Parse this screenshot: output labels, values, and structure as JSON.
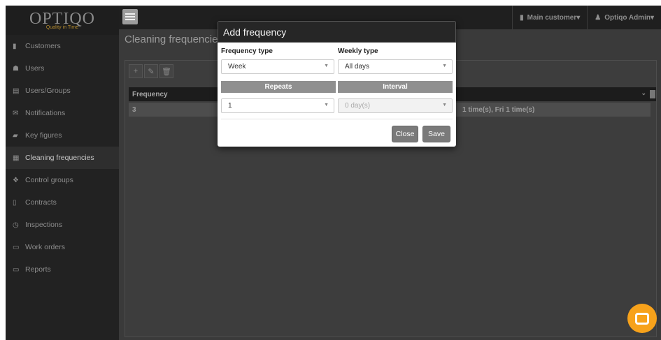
{
  "brand": {
    "name": "OPTIQO",
    "tagline": "Quality in Time"
  },
  "sidebar": {
    "items": [
      {
        "label": "Customers",
        "icon": "building-icon"
      },
      {
        "label": "Users",
        "icon": "users-icon"
      },
      {
        "label": "Users/Groups",
        "icon": "id-card-icon"
      },
      {
        "label": "Notifications",
        "icon": "envelope-icon"
      },
      {
        "label": "Key figures",
        "icon": "book-icon"
      },
      {
        "label": "Cleaning frequencies",
        "icon": "calendar-icon"
      },
      {
        "label": "Control groups",
        "icon": "cubes-icon"
      },
      {
        "label": "Contracts",
        "icon": "file-icon"
      },
      {
        "label": "Inspections",
        "icon": "clock-icon"
      },
      {
        "label": "Work orders",
        "icon": "list-icon"
      },
      {
        "label": "Reports",
        "icon": "monitor-icon"
      }
    ],
    "active_index": 5
  },
  "topbar": {
    "customer_label": "Main customer",
    "user_label": "Optiqo Admin"
  },
  "page": {
    "title": "Cleaning frequencies"
  },
  "grid": {
    "header": "Frequency",
    "rows": [
      {
        "value": "3",
        "detail": "1 time(s), Fri 1 time(s)"
      }
    ]
  },
  "modal": {
    "title": "Add frequency",
    "frequency_type_label": "Frequency type",
    "frequency_type_value": "Week",
    "weekly_type_label": "Weekly type",
    "weekly_type_value": "All days",
    "repeats_header": "Repeats",
    "interval_header": "Interval",
    "repeats_value": "1",
    "interval_value": "0 day(s)",
    "close_label": "Close",
    "save_label": "Save"
  }
}
